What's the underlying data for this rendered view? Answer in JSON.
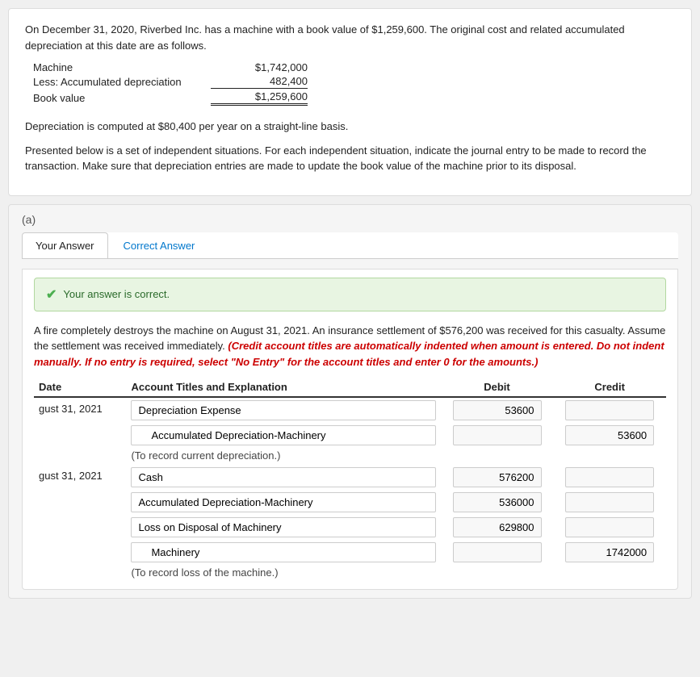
{
  "problem": {
    "intro": "On December 31, 2020, Riverbed Inc. has a machine with a book value of $1,259,600. The original cost and related accumulated depreciation at this date are as follows.",
    "balance": {
      "machine_label": "Machine",
      "machine_amount": "$1,742,000",
      "less_label": "Less: Accumulated depreciation",
      "less_amount": "482,400",
      "bookvalue_label": "Book value",
      "bookvalue_amount": "$1,259,600"
    },
    "depreciation_note": "Depreciation is computed at $80,400 per year on a straight-line basis.",
    "instructions": "Presented below is a set of independent situations. For each independent situation, indicate the journal entry to be made to record the transaction. Make sure that depreciation entries are made to update the book value of the machine prior to its disposal."
  },
  "question": {
    "part_label": "(a)",
    "tabs": {
      "your_answer": "Your Answer",
      "correct_answer": "Correct Answer"
    },
    "correct_banner": "Your answer is correct.",
    "scenario": "A fire completely destroys the machine on August 31, 2021. An insurance settlement of $576,200 was received for this casualty. Assume the settlement was received immediately.",
    "red_note": "(Credit account titles are automatically indented when amount is entered. Do not indent manually. If no entry is required, select \"No Entry\" for the account titles and enter 0 for the amounts.)",
    "table": {
      "headers": {
        "date": "Date",
        "account": "Account Titles and Explanation",
        "debit": "Debit",
        "credit": "Credit"
      },
      "entry1": {
        "date": "gust 31, 2021",
        "rows": [
          {
            "account": "Depreciation Expense",
            "debit": "53600",
            "credit": "",
            "indented": false
          },
          {
            "account": "Accumulated Depreciation-Machinery",
            "debit": "",
            "credit": "53600",
            "indented": true
          }
        ],
        "note": "(To record current depreciation.)"
      },
      "entry2": {
        "date": "gust 31, 2021",
        "rows": [
          {
            "account": "Cash",
            "debit": "576200",
            "credit": "",
            "indented": false
          },
          {
            "account": "Accumulated Depreciation-Machinery",
            "debit": "536000",
            "credit": "",
            "indented": false
          },
          {
            "account": "Loss on Disposal of Machinery",
            "debit": "629800",
            "credit": "",
            "indented": false
          },
          {
            "account": "Machinery",
            "debit": "",
            "credit": "1742000",
            "indented": false
          }
        ],
        "note": "(To record loss of the machine.)"
      }
    }
  }
}
